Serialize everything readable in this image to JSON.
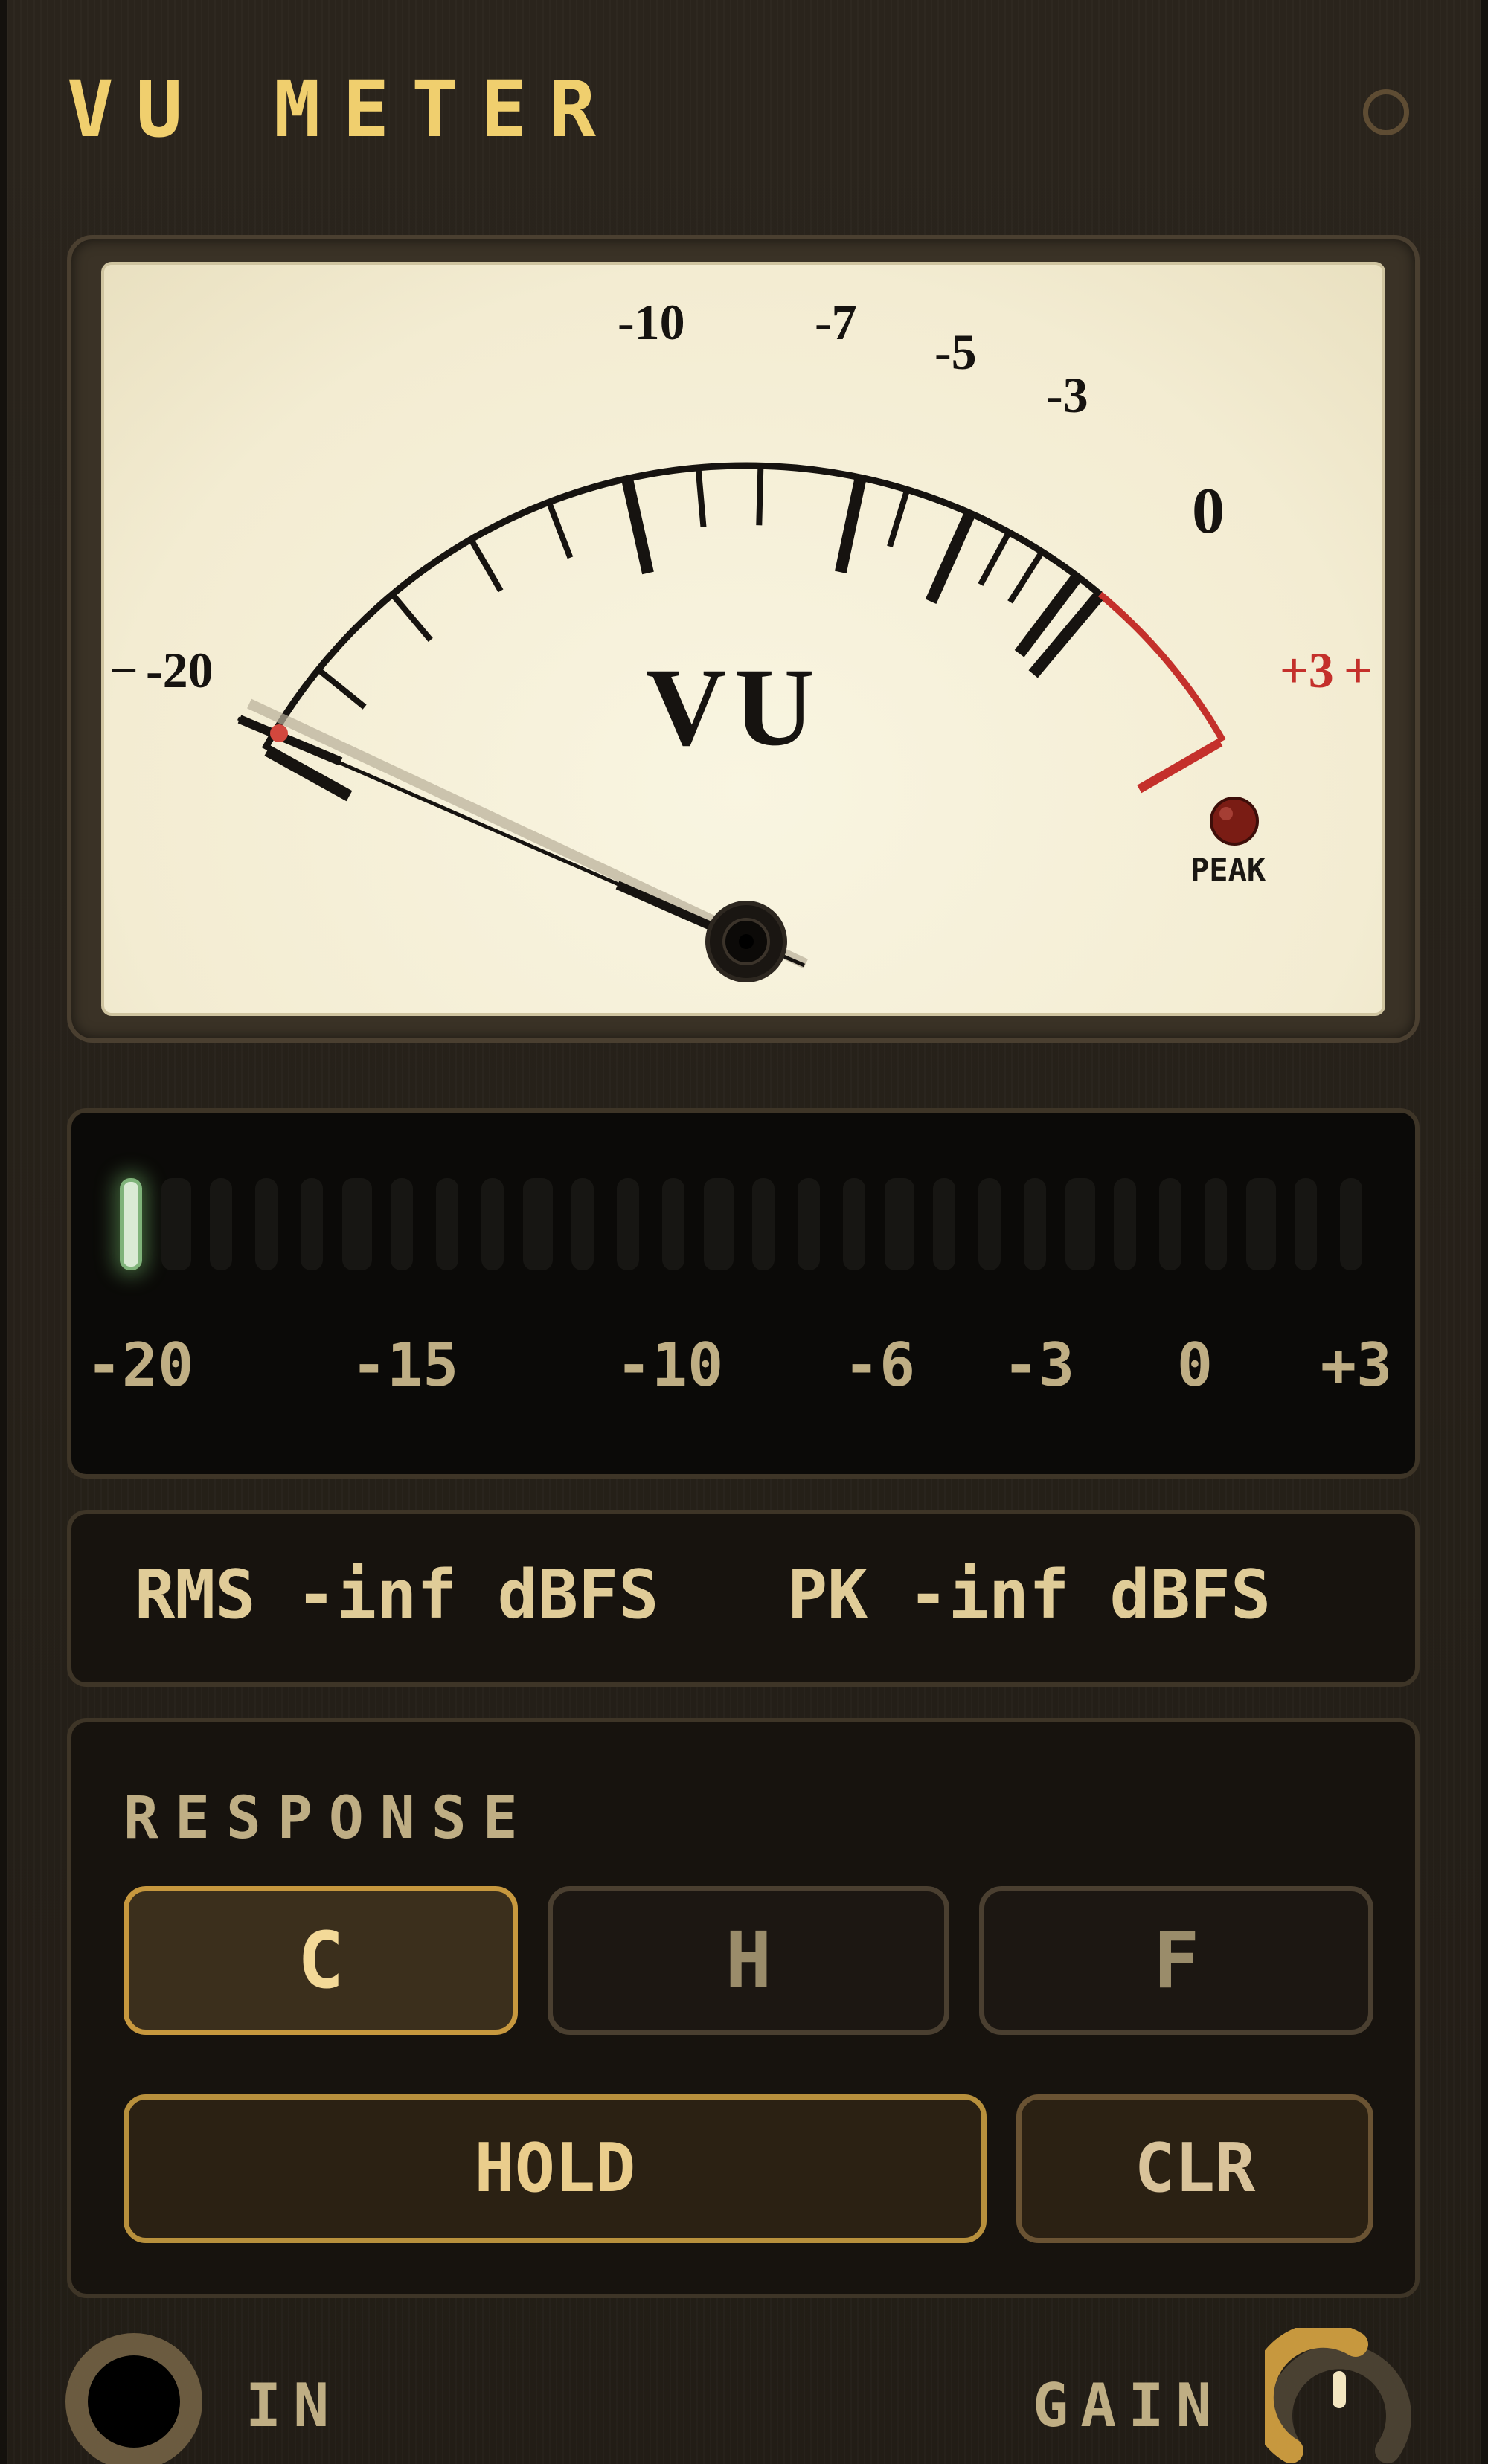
{
  "app": {
    "title": "VU METER"
  },
  "meter": {
    "scale_labels": [
      "-20",
      "-10",
      "-7",
      "-5",
      "-3",
      "0",
      "+3"
    ],
    "center_label": "VU",
    "peak_label": "PEAK",
    "needle_level_db": -20,
    "colors": {
      "face": "#f3ecd2",
      "ink": "#161310",
      "red_zone": "#c4302b"
    }
  },
  "led_bar": {
    "segment_count": 28,
    "lit_segments": 1,
    "scale": [
      "-20",
      "-15",
      "-10",
      "-6",
      "-3",
      "0",
      "+3"
    ],
    "lit_color": "#7fb37a"
  },
  "readout": {
    "rms": "RMS -inf dBFS",
    "pk": "PK -inf dBFS"
  },
  "response": {
    "label": "RESPONSE",
    "modes": [
      {
        "label": "C",
        "active": true
      },
      {
        "label": "H",
        "active": false
      },
      {
        "label": "F",
        "active": false
      }
    ],
    "hold_label": "HOLD",
    "clr_label": "CLR"
  },
  "footer": {
    "in_label": "IN",
    "gain_label": "GAIN",
    "gain_icon": "gain-knob-icon"
  },
  "accent": "#f0cf6e"
}
